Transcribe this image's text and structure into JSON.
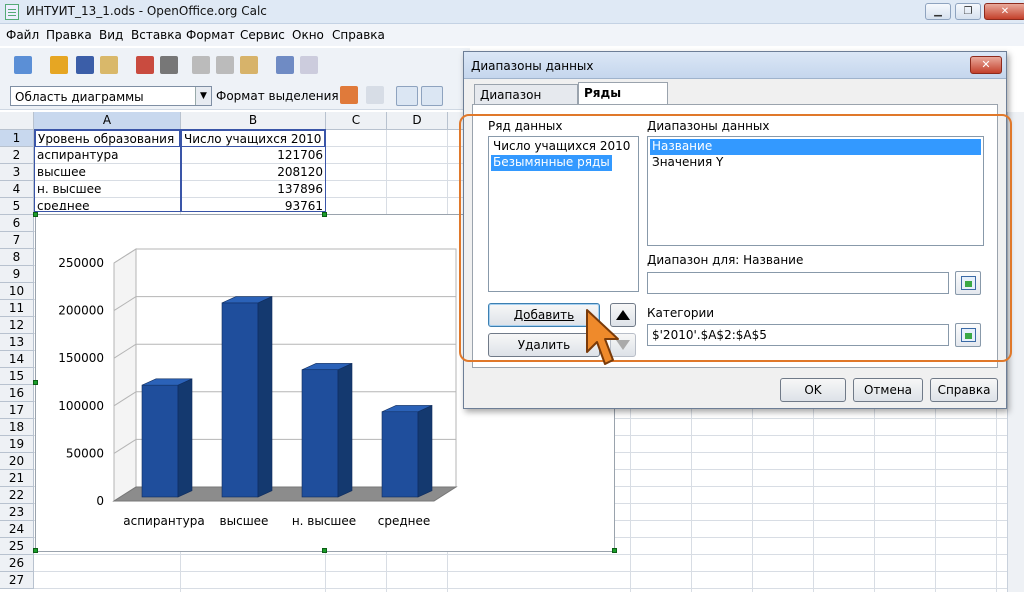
{
  "window": {
    "title": "ИНТУИТ_13_1.ods - OpenOffice.org Calc",
    "minimize_label": "▁",
    "maximize_label": "❐",
    "close_label": "✕"
  },
  "menu": [
    "Файл",
    "Правка",
    "Вид",
    "Вставка",
    "Формат",
    "Сервис",
    "Окно",
    "Справка"
  ],
  "toolbar2": {
    "object_select": "Область диаграммы",
    "format_selection": "Формат выделения"
  },
  "sheet": {
    "columns": [
      "A",
      "B",
      "C",
      "D"
    ],
    "rows": [
      "1",
      "2",
      "3",
      "4",
      "5",
      "6",
      "7",
      "8",
      "9",
      "10",
      "11",
      "12",
      "13",
      "14",
      "15",
      "16",
      "17",
      "18",
      "19",
      "20",
      "21",
      "22",
      "23",
      "24",
      "25",
      "26",
      "27"
    ],
    "cells": [
      {
        "a": "Уровень образования",
        "b": "Число учащихся 2010"
      },
      {
        "a": "аспирантура",
        "b": "121706"
      },
      {
        "a": "высшее",
        "b": "208120"
      },
      {
        "a": "н. высшее",
        "b": "137896"
      },
      {
        "a": "среднее",
        "b": "93761"
      }
    ]
  },
  "chart_data": {
    "type": "bar",
    "categories": [
      "аспирантура",
      "высшее",
      "н. высшее",
      "среднее"
    ],
    "values": [
      121706,
      208120,
      137896,
      93761
    ],
    "ylim": [
      0,
      250000
    ],
    "yticks": [
      "0",
      "50000",
      "100000",
      "150000",
      "200000",
      "250000"
    ],
    "title": "",
    "xlabel": "",
    "ylabel": "",
    "grid": true,
    "bar_color": "#1f4e9c"
  },
  "dialog": {
    "title": "Диапазоны данных",
    "tabs": [
      "Диапазон данных",
      "Ряды данных"
    ],
    "active_tab": "Ряды данных",
    "series_label": "Ряд данных",
    "series": [
      "Число учащихся 2010",
      "Безымянные ряды"
    ],
    "ranges_label": "Диапазоны данных",
    "ranges": [
      "Название",
      "Значения Y"
    ],
    "range_for_label": "Диапазон для: Название",
    "range_for_value": "",
    "categories_label": "Категории",
    "categories_value": "$'2010'.$A$2:$A$5",
    "add_button": "Добавить",
    "remove_button": "Удалить",
    "ok_button": "OK",
    "cancel_button": "Отмена",
    "help_button": "Справка"
  }
}
